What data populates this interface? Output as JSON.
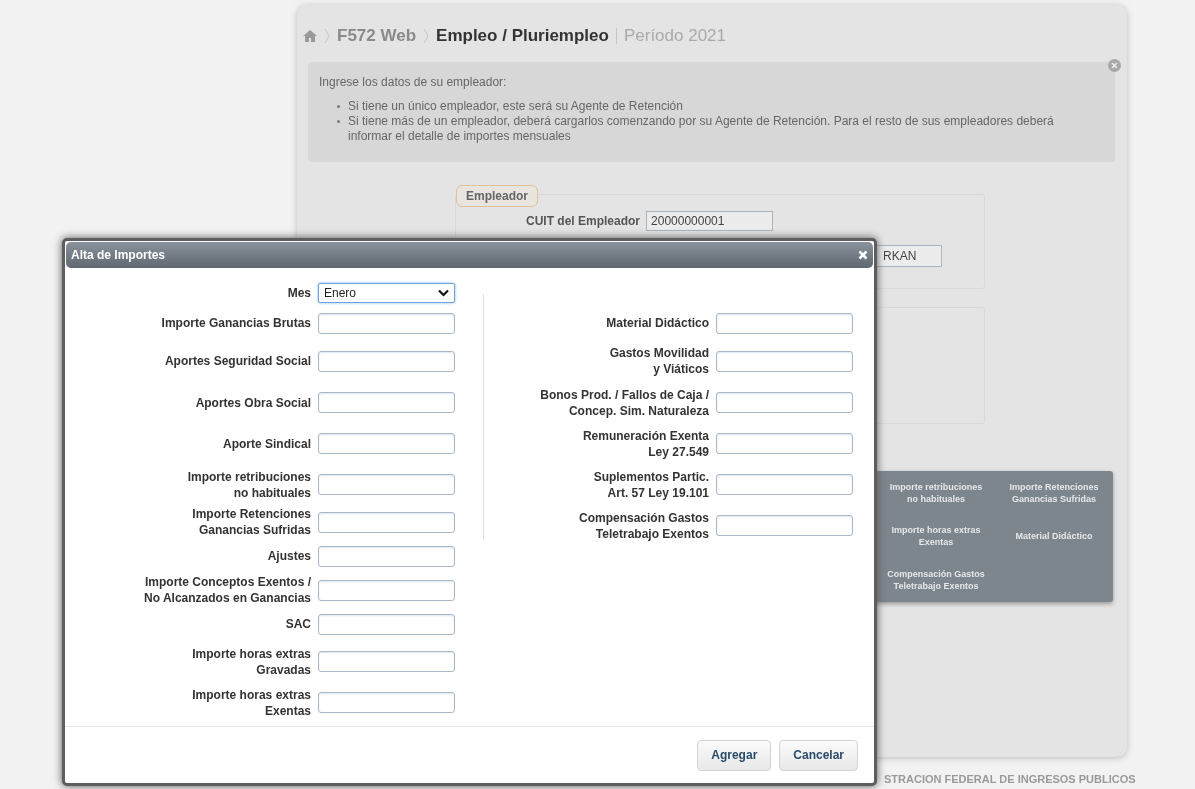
{
  "page": {
    "breadcrumb": [
      {
        "label": "F572 Web",
        "kind": "link"
      },
      {
        "label": "Empleo / Pluriempleo",
        "kind": "current"
      }
    ],
    "period": "Período 2021",
    "info": {
      "intro": "Ingrese los datos de su empleador:",
      "bullets": [
        "Si tiene un único empleador, este será su Agente de Retención",
        "Si tiene más de un empleador, deberá cargarlos comenzando por su Agente de Retención. Para el resto de sus empleadores deberá informar el detalle de importes mensuales"
      ]
    },
    "employer": {
      "legend": "Empleador",
      "cuit_label": "CUIT del Empleador",
      "cuit_value": "20000000001",
      "field_2_value": "RKAN"
    },
    "summary_panel": [
      "Importe retribuciones\nno habituales",
      "Importe Retenciones\nGanancias Sufridas",
      "Importe horas extras\nExentas",
      "Material Didáctico",
      "Compensación Gastos\nTeletrabajo Exentos"
    ],
    "footer": "STRACION FEDERAL DE INGRESOS PUBLICOS"
  },
  "dialog": {
    "title": "Alta de Importes",
    "left_fields": [
      {
        "label": "Mes",
        "kind": "select",
        "value": "Enero"
      },
      {
        "label": "Importe Ganancias Brutas",
        "kind": "text"
      },
      {
        "label": "Aportes Seguridad Social",
        "kind": "text"
      },
      {
        "label": "Aportes Obra Social",
        "kind": "text"
      },
      {
        "label": "Aporte Sindical",
        "kind": "text"
      },
      {
        "label": "Importe retribuciones\nno habituales",
        "kind": "text"
      },
      {
        "label": "Importe Retenciones\nGanancias Sufridas",
        "kind": "text"
      },
      {
        "label": "Ajustes",
        "kind": "text"
      },
      {
        "label": "Importe Conceptos Exentos /\nNo Alcanzados en Ganancias",
        "kind": "text"
      },
      {
        "label": "SAC",
        "kind": "text"
      },
      {
        "label": "Importe horas extras\nGravadas",
        "kind": "text"
      },
      {
        "label": "Importe horas extras\nExentas",
        "kind": "text"
      }
    ],
    "right_fields": [
      {
        "label": "Material Didáctico",
        "kind": "text"
      },
      {
        "label": "Gastos Movilidad\ny Viáticos",
        "kind": "text"
      },
      {
        "label": "Bonos Prod. / Fallos de Caja /\nConcep. Sim. Naturaleza",
        "kind": "text"
      },
      {
        "label": "Remuneración Exenta\nLey 27.549",
        "kind": "text"
      },
      {
        "label": "Suplementos Partic.\nArt. 57 Ley 19.101",
        "kind": "text"
      },
      {
        "label": "Compensación Gastos\nTeletrabajo Exentos",
        "kind": "text"
      }
    ],
    "buttons": [
      "Agregar",
      "Cancelar"
    ]
  }
}
